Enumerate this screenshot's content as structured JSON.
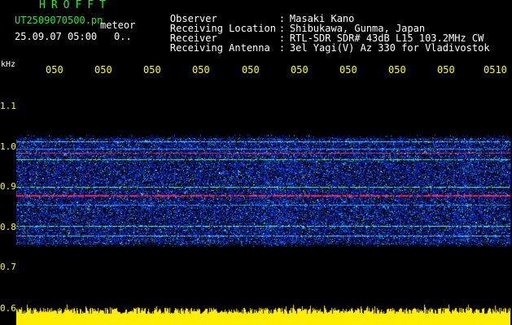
{
  "header": {
    "app_title": "HROFFT",
    "file_name": "UT2509070500.pn",
    "file_suffix": "meteor",
    "datetime": "25.09.07 05:00",
    "counter": "0.."
  },
  "info": [
    {
      "key": "Observer",
      "sep": ":",
      "value": "Masaki Kano"
    },
    {
      "key": "Receiving Location",
      "sep": ":",
      "value": "Shibukawa, Gunma, Japan"
    },
    {
      "key": "Receiver",
      "sep": ":",
      "value": "RTL-SDR SDR# 43dB L15 103.2MHz CW"
    },
    {
      "key": "Receiving Antenna",
      "sep": ":",
      "value": "3el Yagi(V) Az 330 for Vladivostok"
    }
  ],
  "axis": {
    "unit": "kHz",
    "time_ticks": [
      "050",
      "050",
      "050",
      "050",
      "050",
      "050",
      "050",
      "050",
      "050",
      "0510"
    ],
    "freq_ticks": [
      "1.1",
      "1.0",
      "0.9",
      "0.8",
      "0.7",
      "0.6"
    ]
  },
  "colors": {
    "header_green": "#22ee22",
    "axis_yellow": "#ffff00",
    "spectrum_blue": "#1030c0",
    "echo_red": "#ff2050",
    "echo_green": "#40ff80",
    "level_yellow": "#ffee00"
  }
}
